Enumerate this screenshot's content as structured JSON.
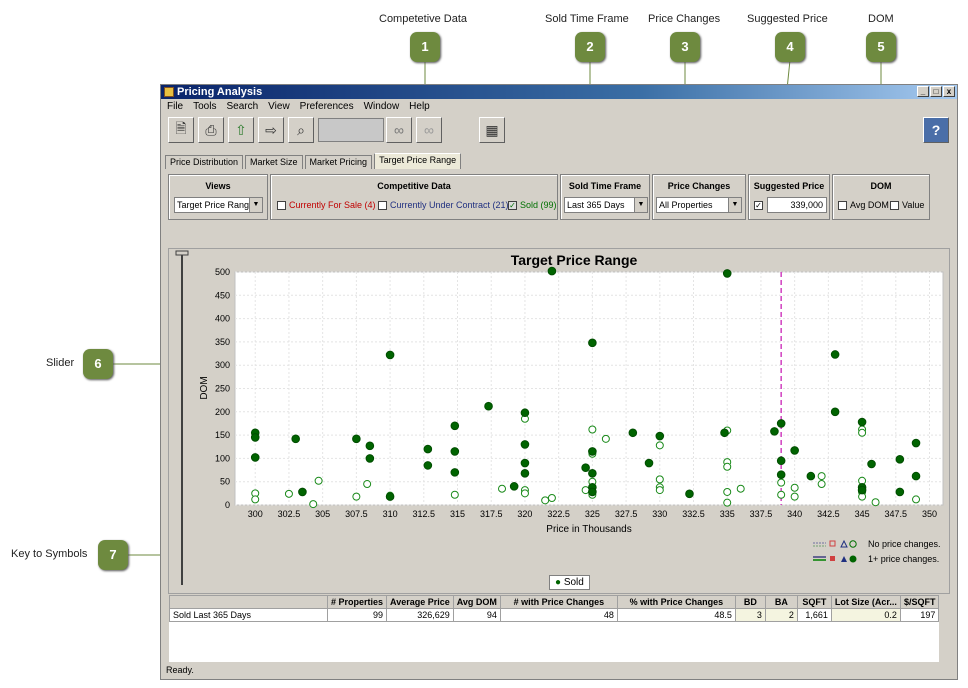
{
  "callouts": [
    {
      "label": "Competetive Data",
      "num": "1"
    },
    {
      "label": "Sold Time Frame",
      "num": "2"
    },
    {
      "label": "Price Changes",
      "num": "3"
    },
    {
      "label": "Suggested Price",
      "num": "4"
    },
    {
      "label": "DOM",
      "num": "5"
    },
    {
      "label": "Slider",
      "num": "6"
    },
    {
      "label": "Key to Symbols",
      "num": "7"
    }
  ],
  "window": {
    "title": "Pricing Analysis",
    "min": "_",
    "max": "□",
    "close": "x"
  },
  "menu": [
    "File",
    "Tools",
    "Search",
    "View",
    "Preferences",
    "Window",
    "Help"
  ],
  "help": "?",
  "tabs": [
    "Price Distribution",
    "Market Size",
    "Market Pricing",
    "Target Price Range"
  ],
  "filters": {
    "views": {
      "title": "Views",
      "value": "Target Price Range"
    },
    "competitive": {
      "title": "Competitive Data",
      "for_sale": "Currently For Sale (4)",
      "under_contract": "Currently Under Contract (21)",
      "sold": "Sold (99)"
    },
    "sold_time": {
      "title": "Sold Time Frame",
      "value": "Last 365 Days"
    },
    "price_changes": {
      "title": "Price Changes",
      "value": "All Properties"
    },
    "suggested": {
      "title": "Suggested Price",
      "value": "339,000"
    },
    "dom": {
      "title": "DOM",
      "avg": "Avg DOM",
      "value": "Value"
    }
  },
  "colors": {
    "for_sale": "#c00000",
    "under_contract": "#203080",
    "sold": "#007000"
  },
  "chart_data": {
    "type": "scatter",
    "title": "Target Price Range",
    "xlabel": "Price in Thousands",
    "ylabel": "DOM",
    "xlim": [
      298.5,
      351
    ],
    "ylim": [
      0,
      500
    ],
    "xticks": [
      300,
      302.5,
      305,
      307.5,
      310,
      312.5,
      315,
      317.5,
      320,
      322.5,
      325,
      327.5,
      330,
      332.5,
      335,
      337.5,
      340,
      342.5,
      345,
      347.5,
      350
    ],
    "yticks": [
      0,
      50,
      100,
      150,
      200,
      250,
      300,
      350,
      400,
      450,
      500
    ],
    "suggested_price": 339,
    "grid": true,
    "series": [
      {
        "name": "No price changes.",
        "filled": false,
        "points": [
          [
            300,
            25
          ],
          [
            300,
            12
          ],
          [
            302.5,
            24
          ],
          [
            304.7,
            52
          ],
          [
            304.3,
            2
          ],
          [
            307.5,
            18
          ],
          [
            308.3,
            45
          ],
          [
            310,
            20
          ],
          [
            314.8,
            22
          ],
          [
            318.3,
            35
          ],
          [
            320,
            32
          ],
          [
            320,
            25
          ],
          [
            320,
            185
          ],
          [
            321.5,
            10
          ],
          [
            322,
            15
          ],
          [
            324.5,
            32
          ],
          [
            325,
            162
          ],
          [
            325,
            110
          ],
          [
            325,
            50
          ],
          [
            325,
            22
          ],
          [
            326,
            142
          ],
          [
            330,
            128
          ],
          [
            330,
            55
          ],
          [
            330,
            38
          ],
          [
            330,
            32
          ],
          [
            335,
            160
          ],
          [
            335,
            92
          ],
          [
            335,
            82
          ],
          [
            335,
            28
          ],
          [
            335,
            5
          ],
          [
            336,
            35
          ],
          [
            339,
            48
          ],
          [
            339,
            22
          ],
          [
            340,
            37
          ],
          [
            340,
            18
          ],
          [
            342,
            62
          ],
          [
            342,
            45
          ],
          [
            345,
            162
          ],
          [
            345,
            155
          ],
          [
            345,
            52
          ],
          [
            345,
            28
          ],
          [
            345,
            18
          ],
          [
            346,
            6
          ],
          [
            349,
            12
          ]
        ]
      },
      {
        "name": "1+ price changes.",
        "filled": true,
        "points": [
          [
            300,
            155
          ],
          [
            300,
            145
          ],
          [
            300,
            102
          ],
          [
            303,
            142
          ],
          [
            303.5,
            28
          ],
          [
            307.5,
            142
          ],
          [
            308.5,
            127
          ],
          [
            308.5,
            100
          ],
          [
            310,
            322
          ],
          [
            310,
            18
          ],
          [
            312.8,
            120
          ],
          [
            312.8,
            85
          ],
          [
            314.8,
            170
          ],
          [
            314.8,
            115
          ],
          [
            314.8,
            70
          ],
          [
            317.3,
            212
          ],
          [
            319.2,
            40
          ],
          [
            320,
            198
          ],
          [
            320,
            130
          ],
          [
            320,
            90
          ],
          [
            320,
            68
          ],
          [
            322,
            502
          ],
          [
            324.5,
            80
          ],
          [
            325,
            348
          ],
          [
            325,
            115
          ],
          [
            325,
            68
          ],
          [
            325,
            38
          ],
          [
            325,
            28
          ],
          [
            328,
            155
          ],
          [
            329.2,
            90
          ],
          [
            330,
            148
          ],
          [
            332.2,
            24
          ],
          [
            334.8,
            155
          ],
          [
            335,
            497
          ],
          [
            338.5,
            158
          ],
          [
            339,
            175
          ],
          [
            339,
            95
          ],
          [
            339,
            65
          ],
          [
            340,
            117
          ],
          [
            341.2,
            62
          ],
          [
            343,
            323
          ],
          [
            343,
            200
          ],
          [
            345,
            178
          ],
          [
            345,
            38
          ],
          [
            345,
            32
          ],
          [
            345.7,
            88
          ],
          [
            347.8,
            98
          ],
          [
            347.8,
            28
          ],
          [
            349,
            133
          ],
          [
            349,
            62
          ]
        ]
      }
    ]
  },
  "key": {
    "no_change": "No price changes.",
    "price_change": "1+ price changes."
  },
  "legend_sold": "Sold",
  "table": {
    "headers": [
      "",
      "# Properties",
      "Average Price",
      "Avg DOM",
      "# with Price Changes",
      "% with Price Changes",
      "BD",
      "BA",
      "SQFT",
      "Lot Size (Acr...",
      "$/SQFT"
    ],
    "rows": [
      [
        "Sold Last 365 Days",
        "99",
        "326,629",
        "94",
        "48",
        "48.5",
        "3",
        "2",
        "1,661",
        "0.2",
        "197"
      ]
    ]
  },
  "status": "Ready."
}
